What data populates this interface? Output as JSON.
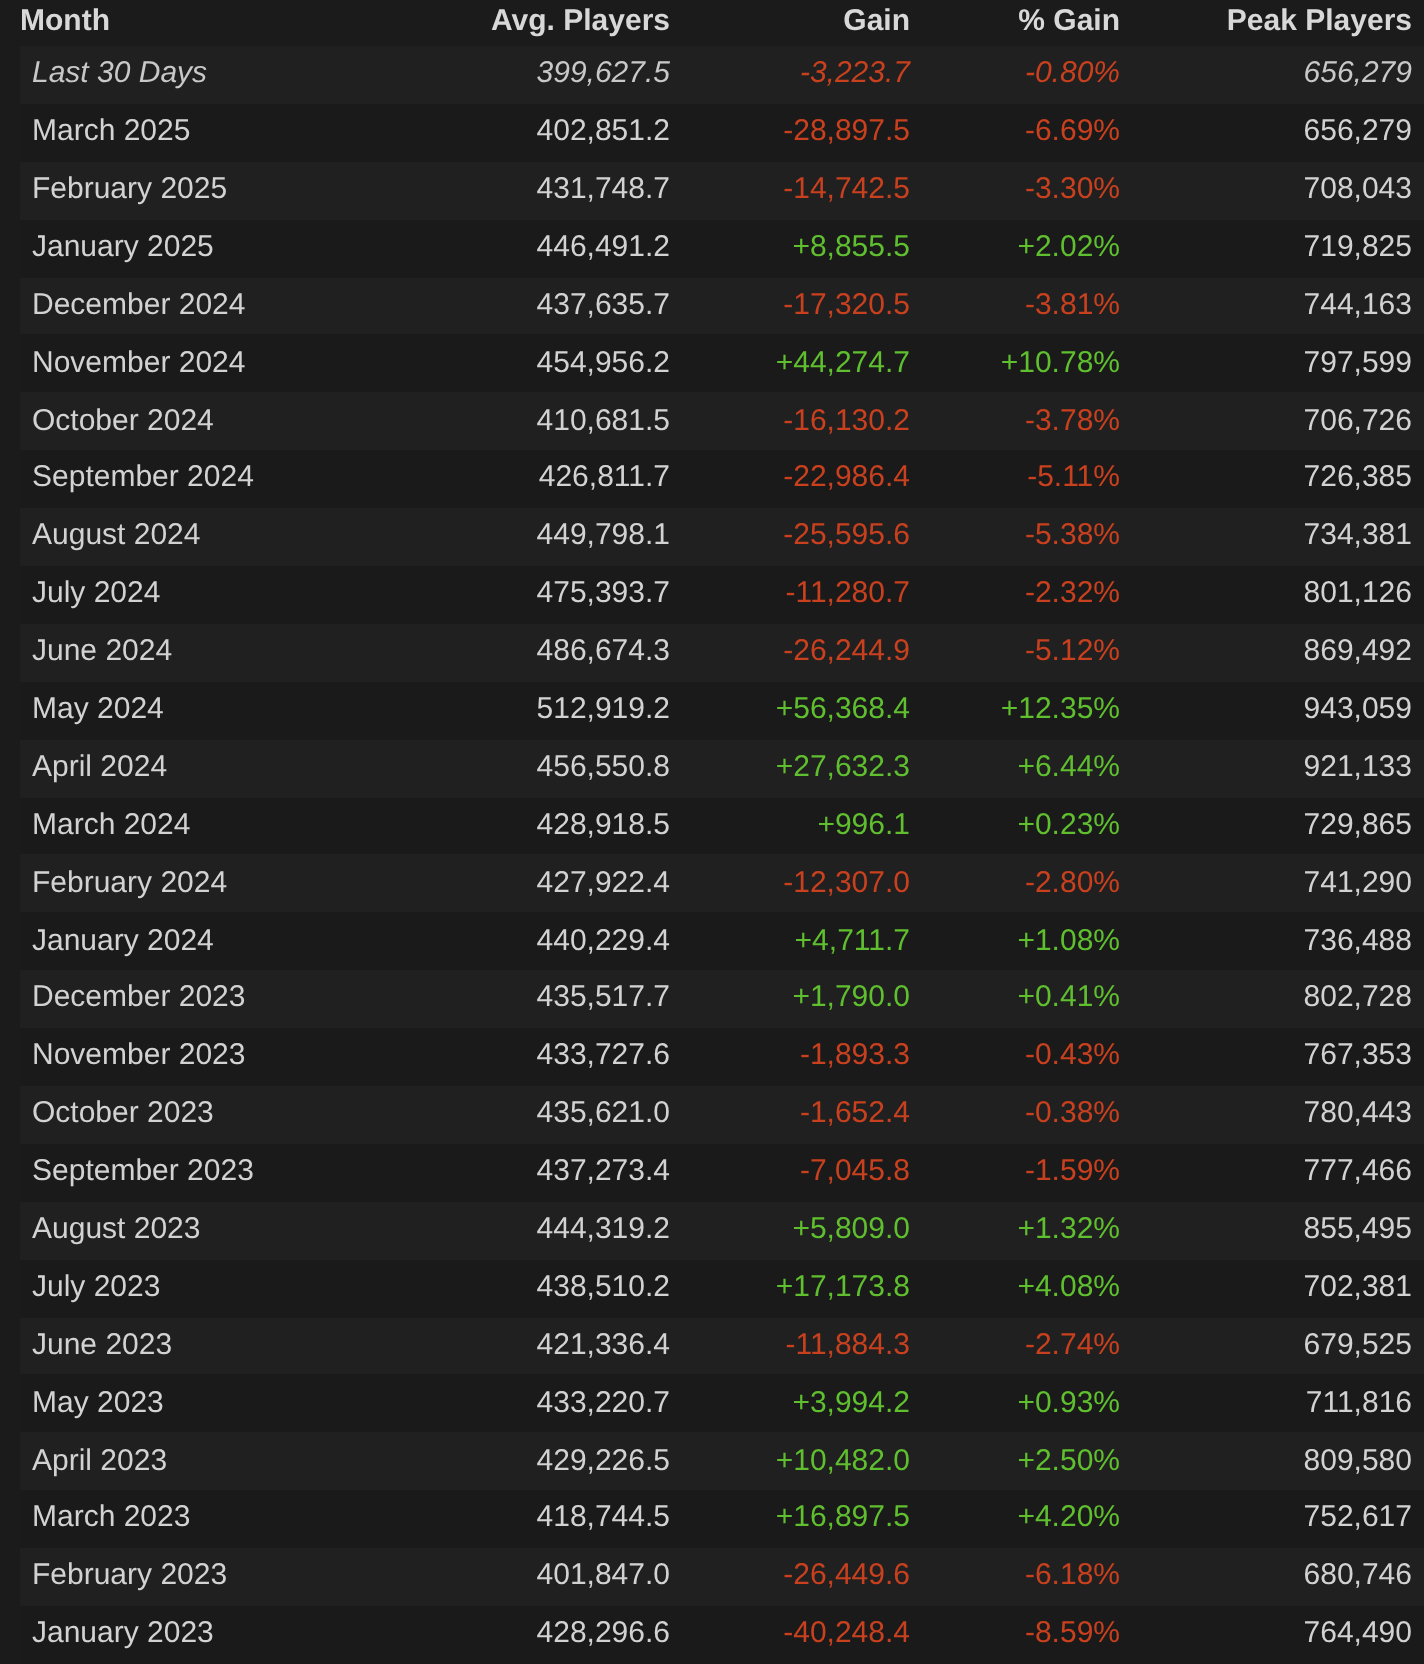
{
  "columns": [
    "Month",
    "Avg. Players",
    "Gain",
    "% Gain",
    "Peak Players"
  ],
  "rows": [
    {
      "kind": "summary",
      "month": "Last 30 Days",
      "avg": "399,627.5",
      "gain": "-3,223.7",
      "pct": "-0.80%",
      "peak": "656,279",
      "color": "#c8401e"
    },
    {
      "kind": "month",
      "month": "March 2025",
      "avg": "402,851.2",
      "gain": "-28,897.5",
      "pct": "-6.69%",
      "peak": "656,279",
      "color": "#c8401e"
    },
    {
      "kind": "month",
      "month": "February 2025",
      "avg": "431,748.7",
      "gain": "-14,742.5",
      "pct": "-3.30%",
      "peak": "708,043",
      "color": "#c8401e"
    },
    {
      "kind": "month",
      "month": "January 2025",
      "avg": "446,491.2",
      "gain": "+8,855.5",
      "pct": "+2.02%",
      "peak": "719,825",
      "color": "#5fbf2f"
    },
    {
      "kind": "month",
      "month": "December 2024",
      "avg": "437,635.7",
      "gain": "-17,320.5",
      "pct": "-3.81%",
      "peak": "744,163",
      "color": "#c8401e"
    },
    {
      "kind": "month",
      "month": "November 2024",
      "avg": "454,956.2",
      "gain": "+44,274.7",
      "pct": "+10.78%",
      "peak": "797,599",
      "color": "#5fbf2f"
    },
    {
      "kind": "month",
      "month": "October 2024",
      "avg": "410,681.5",
      "gain": "-16,130.2",
      "pct": "-3.78%",
      "peak": "706,726",
      "color": "#c8401e"
    },
    {
      "kind": "month",
      "month": "September 2024",
      "avg": "426,811.7",
      "gain": "-22,986.4",
      "pct": "-5.11%",
      "peak": "726,385",
      "color": "#c8401e"
    },
    {
      "kind": "month",
      "month": "August 2024",
      "avg": "449,798.1",
      "gain": "-25,595.6",
      "pct": "-5.38%",
      "peak": "734,381",
      "color": "#c8401e"
    },
    {
      "kind": "month",
      "month": "July 2024",
      "avg": "475,393.7",
      "gain": "-11,280.7",
      "pct": "-2.32%",
      "peak": "801,126",
      "color": "#c8401e"
    },
    {
      "kind": "month",
      "month": "June 2024",
      "avg": "486,674.3",
      "gain": "-26,244.9",
      "pct": "-5.12%",
      "peak": "869,492",
      "color": "#c8401e"
    },
    {
      "kind": "month",
      "month": "May 2024",
      "avg": "512,919.2",
      "gain": "+56,368.4",
      "pct": "+12.35%",
      "peak": "943,059",
      "color": "#5fbf2f"
    },
    {
      "kind": "month",
      "month": "April 2024",
      "avg": "456,550.8",
      "gain": "+27,632.3",
      "pct": "+6.44%",
      "peak": "921,133",
      "color": "#5fbf2f"
    },
    {
      "kind": "month",
      "month": "March 2024",
      "avg": "428,918.5",
      "gain": "+996.1",
      "pct": "+0.23%",
      "peak": "729,865",
      "color": "#5fbf2f"
    },
    {
      "kind": "month",
      "month": "February 2024",
      "avg": "427,922.4",
      "gain": "-12,307.0",
      "pct": "-2.80%",
      "peak": "741,290",
      "color": "#c8401e"
    },
    {
      "kind": "month",
      "month": "January 2024",
      "avg": "440,229.4",
      "gain": "+4,711.7",
      "pct": "+1.08%",
      "peak": "736,488",
      "color": "#5fbf2f"
    },
    {
      "kind": "month",
      "month": "December 2023",
      "avg": "435,517.7",
      "gain": "+1,790.0",
      "pct": "+0.41%",
      "peak": "802,728",
      "color": "#5fbf2f"
    },
    {
      "kind": "month",
      "month": "November 2023",
      "avg": "433,727.6",
      "gain": "-1,893.3",
      "pct": "-0.43%",
      "peak": "767,353",
      "color": "#c8401e"
    },
    {
      "kind": "month",
      "month": "October 2023",
      "avg": "435,621.0",
      "gain": "-1,652.4",
      "pct": "-0.38%",
      "peak": "780,443",
      "color": "#c8401e"
    },
    {
      "kind": "month",
      "month": "September 2023",
      "avg": "437,273.4",
      "gain": "-7,045.8",
      "pct": "-1.59%",
      "peak": "777,466",
      "color": "#c8401e"
    },
    {
      "kind": "month",
      "month": "August 2023",
      "avg": "444,319.2",
      "gain": "+5,809.0",
      "pct": "+1.32%",
      "peak": "855,495",
      "color": "#5fbf2f"
    },
    {
      "kind": "month",
      "month": "July 2023",
      "avg": "438,510.2",
      "gain": "+17,173.8",
      "pct": "+4.08%",
      "peak": "702,381",
      "color": "#5fbf2f"
    },
    {
      "kind": "month",
      "month": "June 2023",
      "avg": "421,336.4",
      "gain": "-11,884.3",
      "pct": "-2.74%",
      "peak": "679,525",
      "color": "#c8401e"
    },
    {
      "kind": "month",
      "month": "May 2023",
      "avg": "433,220.7",
      "gain": "+3,994.2",
      "pct": "+0.93%",
      "peak": "711,816",
      "color": "#5fbf2f"
    },
    {
      "kind": "month",
      "month": "April 2023",
      "avg": "429,226.5",
      "gain": "+10,482.0",
      "pct": "+2.50%",
      "peak": "809,580",
      "color": "#5fbf2f"
    },
    {
      "kind": "month",
      "month": "March 2023",
      "avg": "418,744.5",
      "gain": "+16,897.5",
      "pct": "+4.20%",
      "peak": "752,617",
      "color": "#5fbf2f"
    },
    {
      "kind": "month",
      "month": "February 2023",
      "avg": "401,847.0",
      "gain": "-26,449.6",
      "pct": "-6.18%",
      "peak": "680,746",
      "color": "#c8401e"
    },
    {
      "kind": "month",
      "month": "January 2023",
      "avg": "428,296.6",
      "gain": "-40,248.4",
      "pct": "-8.59%",
      "peak": "764,490",
      "color": "#c8401e"
    }
  ]
}
